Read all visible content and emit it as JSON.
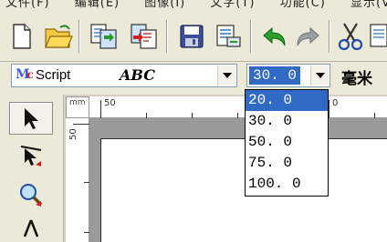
{
  "menubar": {
    "items": [
      "文件(F)",
      "编辑(E)",
      "图像(I)",
      "文字(T)",
      "功能(C)",
      "显示(V)"
    ]
  },
  "toolbar": {
    "buttons": [
      "new-icon",
      "open-icon",
      "import-icon",
      "export-icon",
      "save-icon",
      "print-icon",
      "undo-icon",
      "redo-icon",
      "cut-icon",
      "copy-icon"
    ]
  },
  "fontbar": {
    "font_name": "Script",
    "font_sample": "ABC",
    "size_value": "30. 0",
    "unit": "毫米"
  },
  "size_dropdown": {
    "options": [
      "20. 0",
      "30. 0",
      "50. 0",
      "75. 0",
      "100. 0"
    ],
    "highlighted": "20. 0"
  },
  "ruler": {
    "unit_label": "mm",
    "h_labels": [
      "50",
      "0"
    ],
    "v_labels": [
      "50"
    ]
  },
  "tools": [
    "select-tool",
    "node-edit-tool",
    "zoom-tool",
    "text-tool"
  ],
  "colors": {
    "selection": "#316ac5",
    "toolbar_bg": "#ece9d8",
    "canvas_bg": "#9a9a9a"
  }
}
